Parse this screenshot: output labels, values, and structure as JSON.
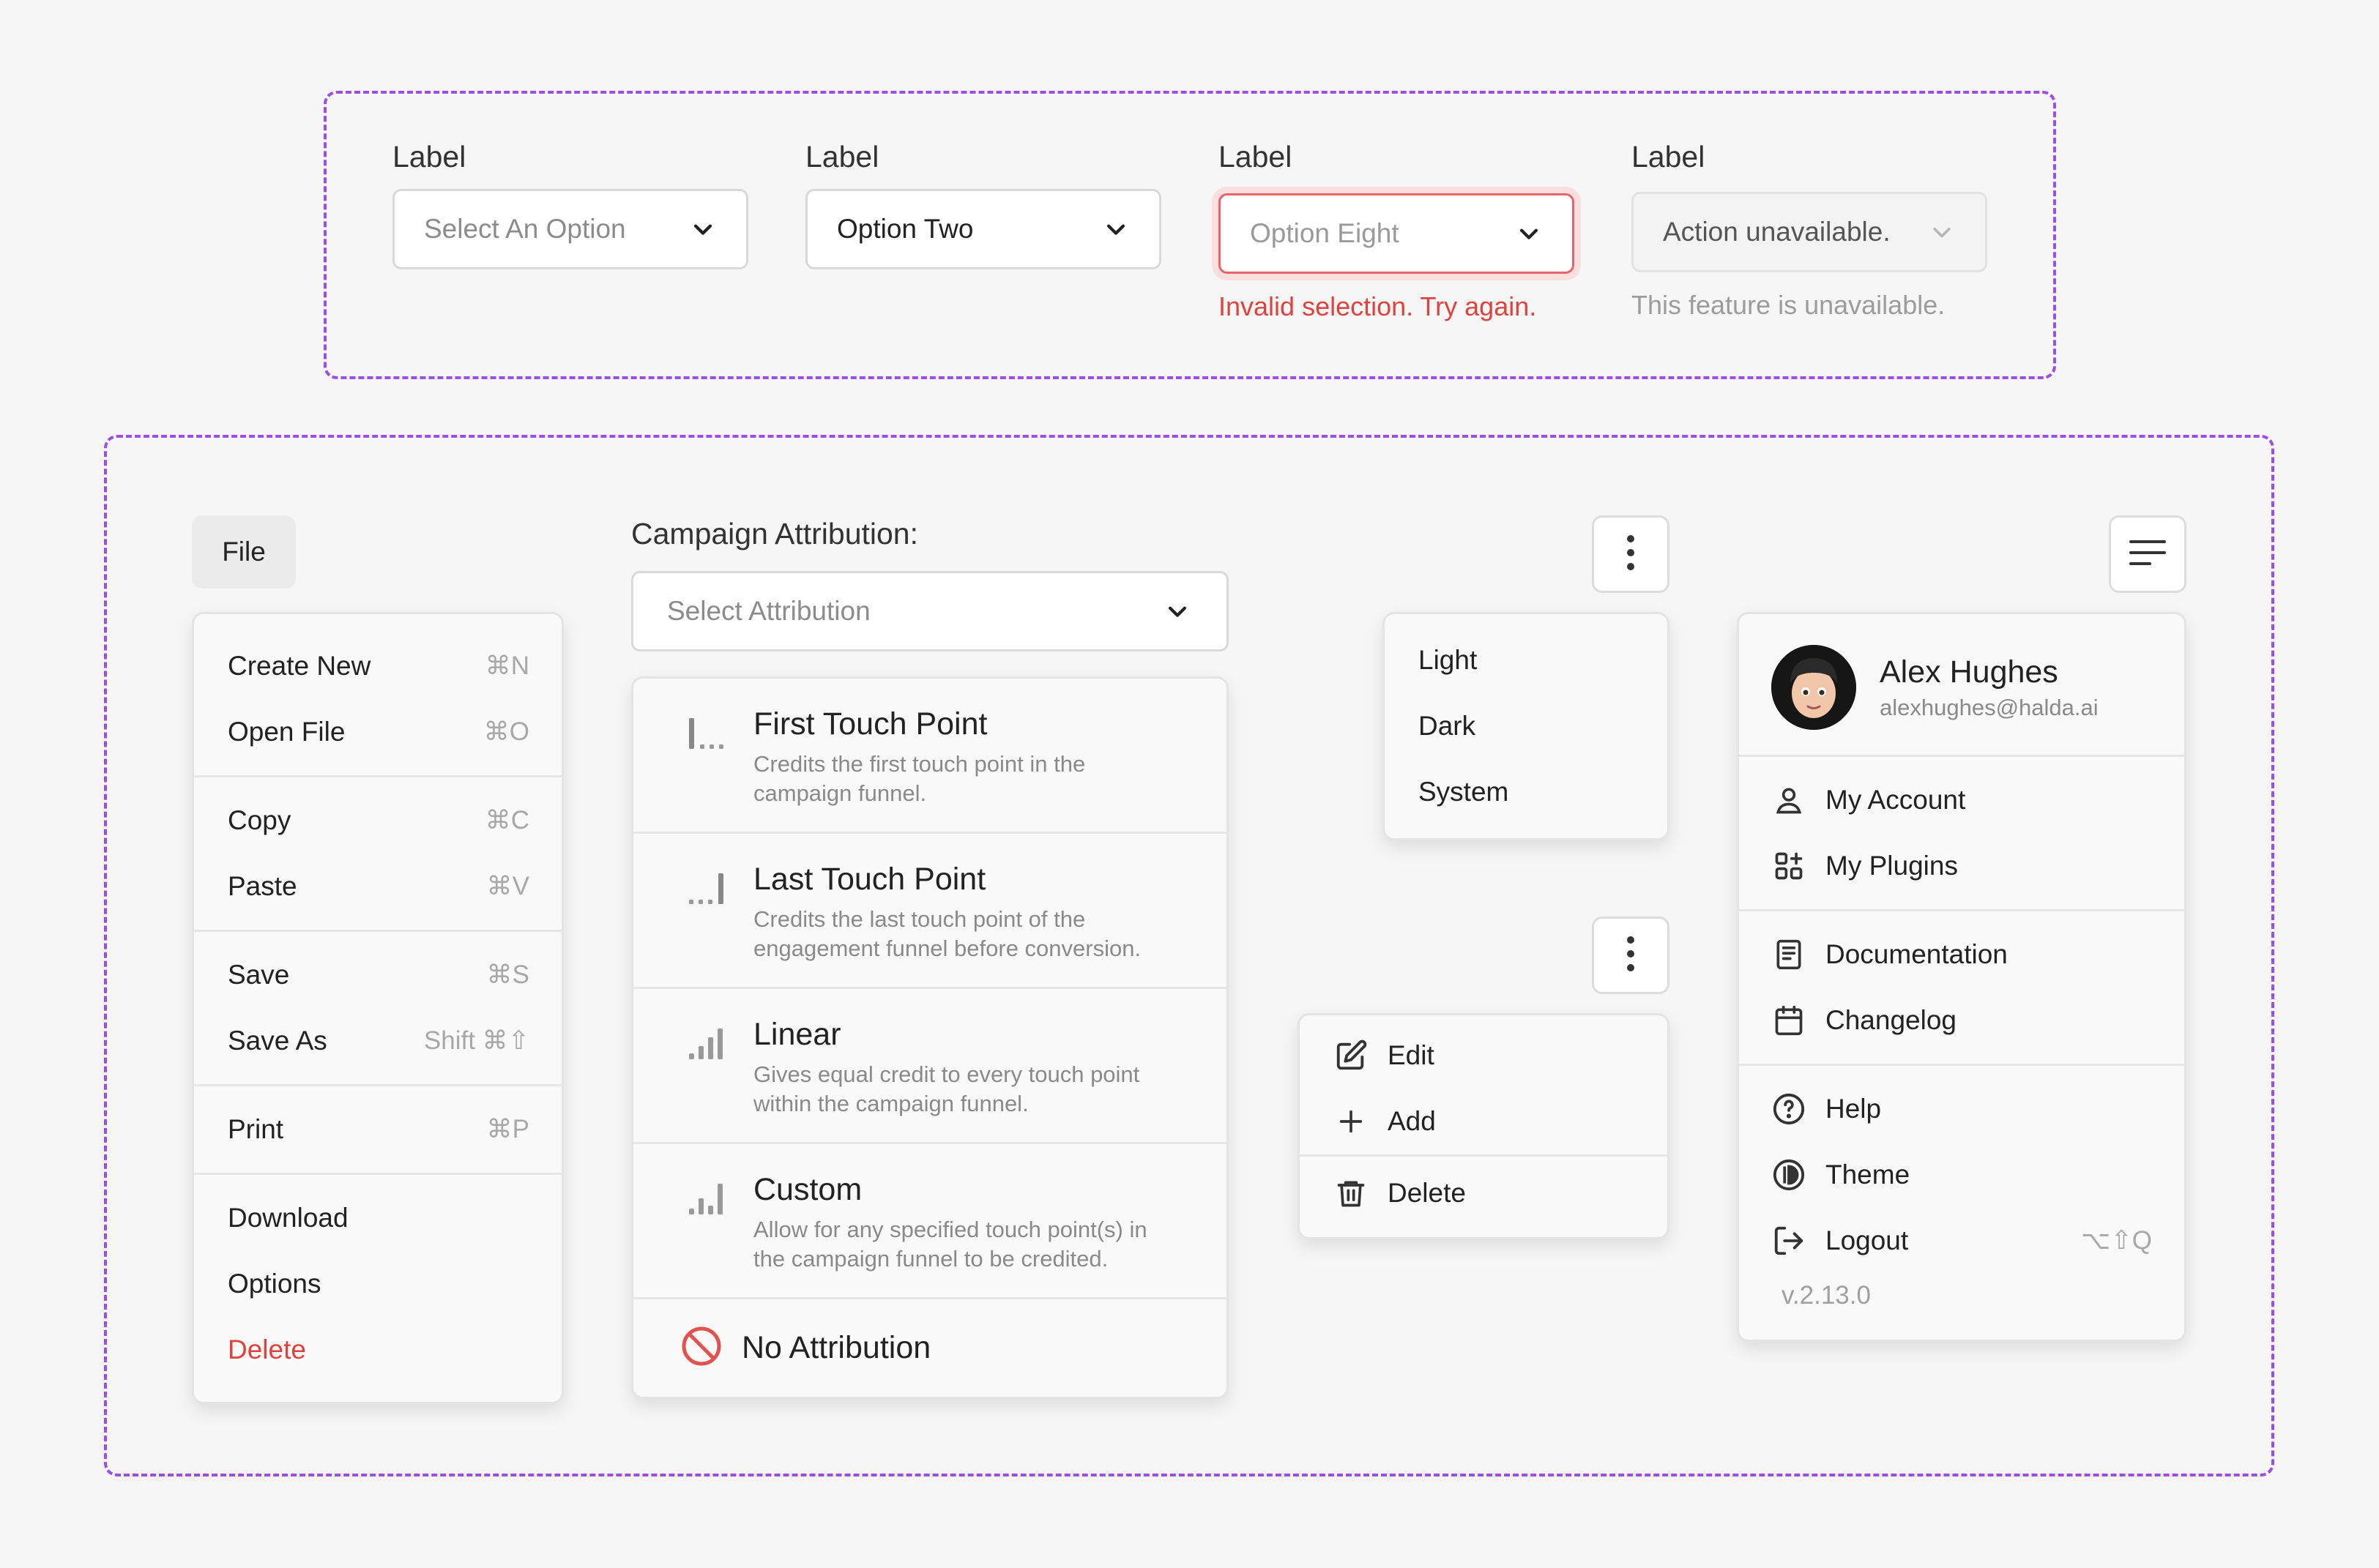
{
  "selects": [
    {
      "label": "Label",
      "value": "Select An Option",
      "state": "placeholder",
      "helper": ""
    },
    {
      "label": "Label",
      "value": "Option Two",
      "state": "filled",
      "helper": ""
    },
    {
      "label": "Label",
      "value": "Option Eight",
      "state": "error",
      "helper": "Invalid selection. Try again."
    },
    {
      "label": "Label",
      "value": "Action unavailable.",
      "state": "disabled",
      "helper": "This feature is unavailable."
    }
  ],
  "file_menu": {
    "button_label": "File",
    "items": [
      {
        "label": "Create New",
        "shortcut": "⌘N"
      },
      {
        "label": "Open File",
        "shortcut": "⌘O"
      },
      {
        "label": "Copy",
        "shortcut": "⌘C"
      },
      {
        "label": "Paste",
        "shortcut": "⌘V"
      },
      {
        "label": "Save",
        "shortcut": "⌘S"
      },
      {
        "label": "Save As",
        "shortcut": "Shift ⌘⇧"
      },
      {
        "label": "Print",
        "shortcut": "⌘P"
      },
      {
        "label": "Download",
        "shortcut": ""
      },
      {
        "label": "Options",
        "shortcut": ""
      },
      {
        "label": "Delete",
        "shortcut": ""
      }
    ]
  },
  "campaign": {
    "label": "Campaign Attribution:",
    "placeholder": "Select Attribution",
    "options": [
      {
        "title": "First Touch Point",
        "desc": "Credits the first touch point in the campaign funnel.",
        "icon": "first-touch-icon"
      },
      {
        "title": "Last Touch Point",
        "desc": "Credits the last touch point of the engagement funnel before conversion.",
        "icon": "last-touch-icon"
      },
      {
        "title": "Linear",
        "desc": "Gives equal credit to every touch point within the campaign funnel.",
        "icon": "linear-icon"
      },
      {
        "title": "Custom",
        "desc": "Allow for any specified touch point(s) in the campaign funnel to be credited.",
        "icon": "custom-icon"
      }
    ],
    "none_label": "No Attribution"
  },
  "theme_menu": {
    "items": [
      "Light",
      "Dark",
      "System"
    ]
  },
  "edit_menu": {
    "items": [
      "Edit",
      "Add",
      "Delete"
    ]
  },
  "account_menu": {
    "name": "Alex Hughes",
    "email": "alexhughes@halda.ai",
    "items": [
      {
        "label": "My Account",
        "icon": "user-icon",
        "shortcut": ""
      },
      {
        "label": "My Plugins",
        "icon": "plugins-icon",
        "shortcut": ""
      },
      {
        "label": "Documentation",
        "icon": "document-icon",
        "shortcut": ""
      },
      {
        "label": "Changelog",
        "icon": "calendar-icon",
        "shortcut": ""
      },
      {
        "label": "Help",
        "icon": "help-icon",
        "shortcut": ""
      },
      {
        "label": "Theme",
        "icon": "theme-icon",
        "shortcut": ""
      },
      {
        "label": "Logout",
        "icon": "logout-icon",
        "shortcut": "⌥⇧Q"
      }
    ],
    "version": "v.2.13.0"
  },
  "colors": {
    "accent_dashed": "#9d4ee8",
    "danger": "#e0423d",
    "error_ring": "#fbdede"
  }
}
